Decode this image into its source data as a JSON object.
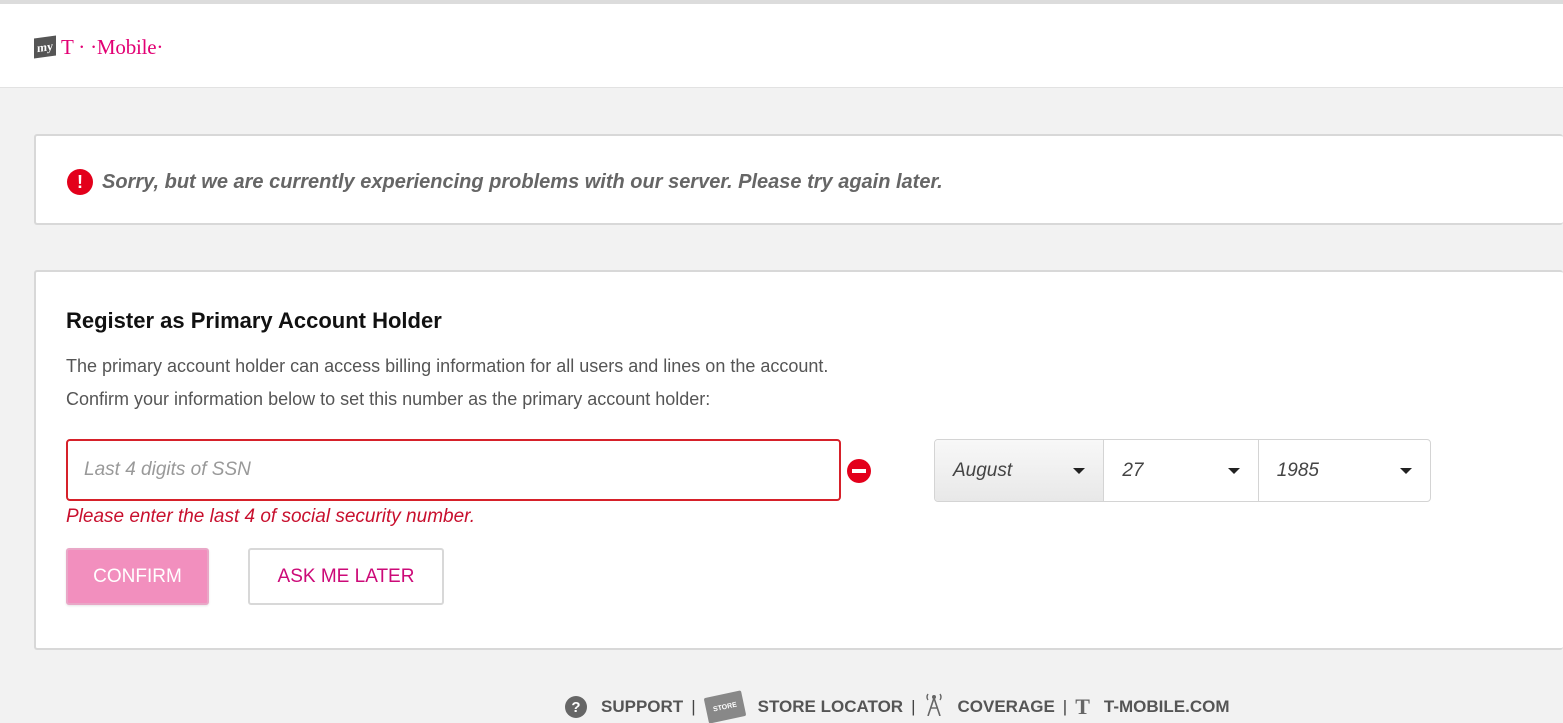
{
  "header": {
    "logo_badge": "my",
    "brand": "T · ·Mobile·"
  },
  "alert": {
    "icon": "exclamation-icon",
    "icon_glyph": "!",
    "message": "Sorry, but we are currently experiencing problems with our server. Please try again later."
  },
  "register": {
    "title": "Register as Primary Account Holder",
    "desc_line1": "The primary account holder can access billing information for all users and lines on the account.",
    "desc_line2": "Confirm your information below to set this number as the primary account holder:",
    "ssn_placeholder": "Last 4 digits of SSN",
    "ssn_value": "",
    "ssn_error": "Please enter the last 4 of social security number.",
    "birth_month": "August",
    "birth_day": "27",
    "birth_year": "1985",
    "confirm_label": "CONFIRM",
    "later_label": "ASK ME LATER"
  },
  "footer": {
    "support": "SUPPORT",
    "store_locator": "STORE LOCATOR",
    "store_badge": "STORE",
    "coverage": "COVERAGE",
    "tmobile_com": "T-MOBILE.COM",
    "separator": "|",
    "t_glyph": "T"
  },
  "colors": {
    "brand": "#e20074",
    "error": "#c8102e",
    "confirm_bg": "#f28fbe"
  }
}
